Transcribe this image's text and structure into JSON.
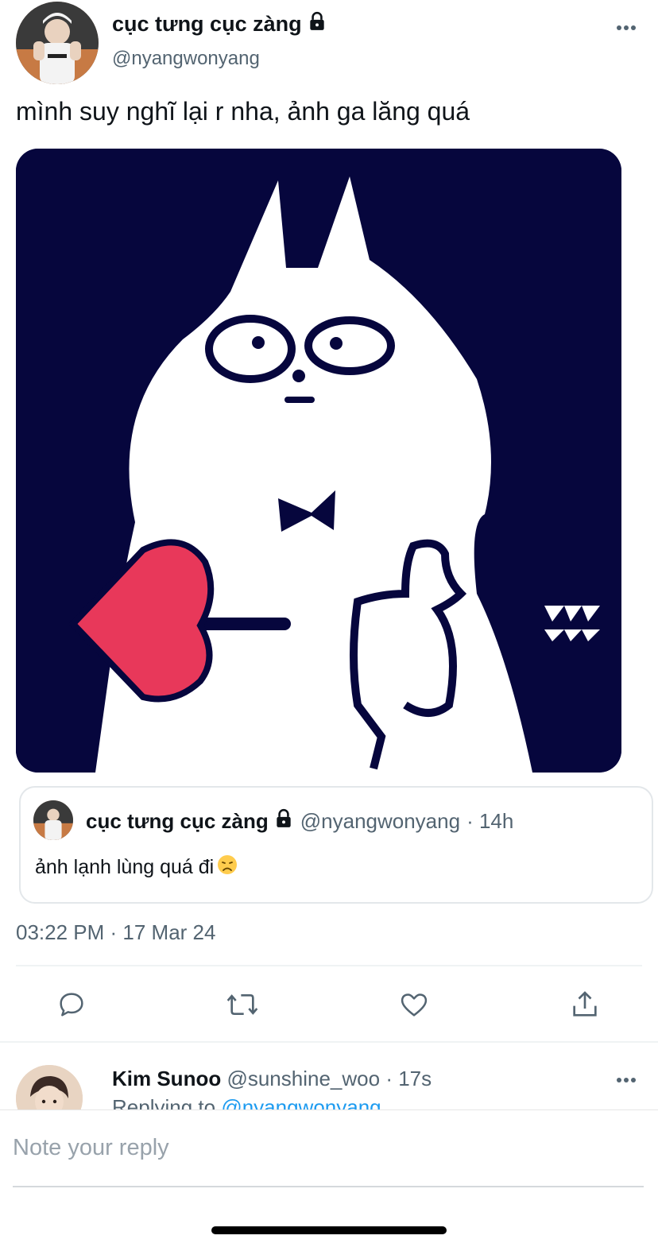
{
  "tweet": {
    "author_name": "cục tưng cục zàng",
    "author_handle": "@nyangwonyang",
    "protected_icon": "lock-icon",
    "text": "mình suy nghĩ lại r nha, ảnh ga lăng quá",
    "media_icon": "cat-sticker-heart-thumbs-up"
  },
  "quote": {
    "author_name": "cục tưng cục zàng",
    "author_handle": "@nyangwonyang",
    "time": "· 14h",
    "text": "ảnh lạnh lùng quá đi",
    "emoji_icon": "disappointed-face-emoji"
  },
  "timestamp": "03:22 PM · 17 Mar 24",
  "actions": [
    "reply-icon",
    "retweet-icon",
    "like-icon",
    "share-icon"
  ],
  "reply_preview": {
    "author_name": "Kim Sunoo",
    "author_handle": "@sunshine_woo",
    "time": "· 17s",
    "replying_to_label": "Replying to",
    "replying_to_handle": "@nyangwonyang"
  },
  "composer": {
    "placeholder": "Note your reply"
  },
  "colors": {
    "media_background": "#06063d",
    "heart": "#e8385a",
    "link": "#1d9bf0",
    "secondary_text": "#536471"
  }
}
